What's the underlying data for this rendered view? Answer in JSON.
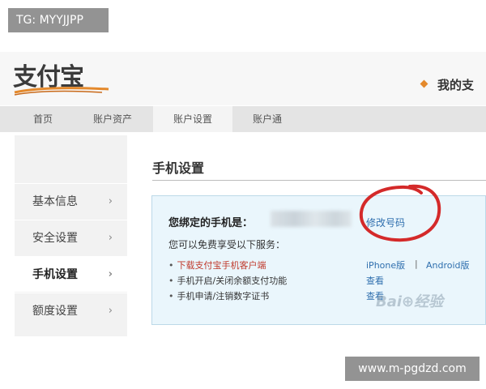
{
  "watermarks": {
    "top_tag": "TG: MYYJJPP",
    "bottom_tag": "www.m-pgdzd.com",
    "baidu": "Bai⊕经验"
  },
  "header": {
    "logo_text": "支付宝",
    "my_alipay": "我的支"
  },
  "nav": {
    "items": [
      {
        "label": "首页"
      },
      {
        "label": "账户资产"
      },
      {
        "label": "账户设置"
      },
      {
        "label": "账户通"
      }
    ],
    "active_index": 2
  },
  "sidebar": {
    "items": [
      {
        "label": "基本信息"
      },
      {
        "label": "安全设置"
      },
      {
        "label": "手机设置"
      },
      {
        "label": "额度设置"
      }
    ],
    "active_index": 2,
    "chevron": "›"
  },
  "main": {
    "title": "手机设置",
    "bound_phone_label": "您绑定的手机是：",
    "change_number_link": "修改号码",
    "free_services_text": "您可以免费享受以下服务：",
    "services": [
      {
        "label": "下载支付宝手机客户端",
        "links": [
          "iPhone版",
          "Android版"
        ]
      },
      {
        "label": "手机开启/关闭余额支付功能",
        "links": [
          "查看"
        ]
      },
      {
        "label": "手机申请/注销数字证书",
        "links": [
          "查看"
        ]
      }
    ],
    "link_separator": "|",
    "bullet": "•"
  },
  "colors": {
    "panel_bg": "#eaf6fc",
    "link": "#2f6fae",
    "highlight_red": "#c0392b",
    "annotation_circle": "#d42a2a",
    "accent_orange": "#e4892c"
  }
}
